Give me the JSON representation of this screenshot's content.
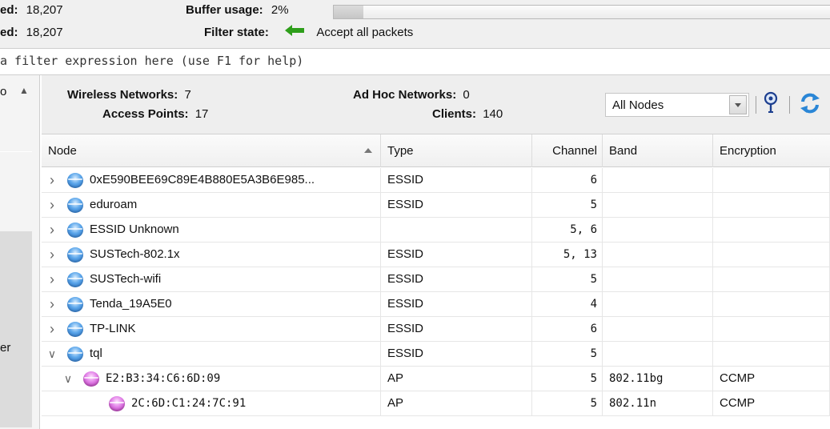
{
  "status": {
    "captured_label": "ed:",
    "captured_value": "18,207",
    "analyzed_label": "ed:",
    "analyzed_value": "18,207",
    "buffer_label": "Buffer usage:",
    "buffer_value": "2%",
    "buffer_fraction": 0.06,
    "filter_state_label": "Filter state:",
    "filter_state_value": "Accept all packets",
    "filter_arrow_color": "#2e9e1a"
  },
  "filter": {
    "placeholder": "a filter expression here (use F1 for help)"
  },
  "left_panel": {
    "top_text": "o",
    "mid_text": "er"
  },
  "summary": {
    "wireless_label": "Wireless Networks:",
    "wireless_value": "7",
    "ap_label": "Access Points:",
    "ap_value": "17",
    "adhoc_label": "Ad Hoc Networks:",
    "adhoc_value": "0",
    "clients_label": "Clients:",
    "clients_value": "140",
    "node_filter": "All Nodes"
  },
  "icons": {
    "locate": "map-pin-icon",
    "refresh": "refresh-icon"
  },
  "table": {
    "columns": [
      "Node",
      "Type",
      "Channel",
      "Band",
      "Encryption"
    ],
    "rows": [
      {
        "node": "0xE590BEE69C89E4B880E5A3B6E985...",
        "type": "ESSID",
        "channel": "6",
        "band": "",
        "encryption": "",
        "level": 0,
        "expander": ">",
        "icon": "blue"
      },
      {
        "node": "eduroam",
        "type": "ESSID",
        "channel": "5",
        "band": "",
        "encryption": "",
        "level": 0,
        "expander": ">",
        "icon": "blue"
      },
      {
        "node": "ESSID Unknown",
        "type": "",
        "channel": "5, 6",
        "band": "",
        "encryption": "",
        "level": 0,
        "expander": ">",
        "icon": "blue"
      },
      {
        "node": "SUSTech-802.1x",
        "type": "ESSID",
        "channel": "5, 13",
        "band": "",
        "encryption": "",
        "level": 0,
        "expander": ">",
        "icon": "blue"
      },
      {
        "node": "SUSTech-wifi",
        "type": "ESSID",
        "channel": "5",
        "band": "",
        "encryption": "",
        "level": 0,
        "expander": ">",
        "icon": "blue"
      },
      {
        "node": "Tenda_19A5E0",
        "type": "ESSID",
        "channel": "4",
        "band": "",
        "encryption": "",
        "level": 0,
        "expander": ">",
        "icon": "blue"
      },
      {
        "node": "TP-LINK",
        "type": "ESSID",
        "channel": "6",
        "band": "",
        "encryption": "",
        "level": 0,
        "expander": ">",
        "icon": "blue"
      },
      {
        "node": "tql",
        "type": "ESSID",
        "channel": "5",
        "band": "",
        "encryption": "",
        "level": 0,
        "expander": "v",
        "icon": "blue"
      },
      {
        "node": "E2:B3:34:C6:6D:09",
        "type": "AP",
        "channel": "5",
        "band": "802.11bg",
        "encryption": "CCMP",
        "level": 1,
        "expander": "v",
        "icon": "pink"
      },
      {
        "node": "2C:6D:C1:24:7C:91",
        "type": "AP",
        "channel": "5",
        "band": "802.11n",
        "encryption": "CCMP",
        "level": 2,
        "expander": "",
        "icon": "pink"
      }
    ]
  }
}
